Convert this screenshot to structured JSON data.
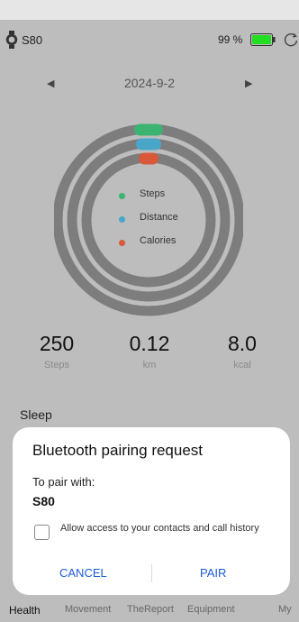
{
  "device": {
    "name": "S80",
    "battery": "99 %"
  },
  "date": {
    "label": "2024-9-2"
  },
  "legend": [
    {
      "label": "Steps",
      "color": "#3cb371"
    },
    {
      "label": "Distance",
      "color": "#4aa6c9"
    },
    {
      "label": "Calories",
      "color": "#d9583a"
    }
  ],
  "stats": [
    {
      "value": "250",
      "unit": "Steps"
    },
    {
      "value": "0.12",
      "unit": "km"
    },
    {
      "value": "8.0",
      "unit": "kcal"
    }
  ],
  "section": {
    "sleep_label": "Sleep"
  },
  "dialog": {
    "title": "Bluetooth pairing request",
    "subtitle": "To pair with:",
    "device": "S80",
    "checkbox_label": "Allow access to your contacts and call history",
    "checkbox_checked": false,
    "cancel_label": "CANCEL",
    "pair_label": "PAIR"
  },
  "nav": [
    {
      "label": "Health",
      "active": true
    },
    {
      "label": "Movement",
      "active": false
    },
    {
      "label": "TheReport",
      "active": false
    },
    {
      "label": "Equipment",
      "active": false
    },
    {
      "label": "My",
      "active": false
    }
  ],
  "icons": {
    "watch": "watch-icon",
    "battery": "battery-icon",
    "sync": "sync-icon",
    "prev": "chevron-left-icon",
    "next": "chevron-right-icon"
  },
  "colors": {
    "battery_fill": "#22dd22",
    "ring_track": "#7d7d7d",
    "accent_button": "#1a5ad6"
  }
}
